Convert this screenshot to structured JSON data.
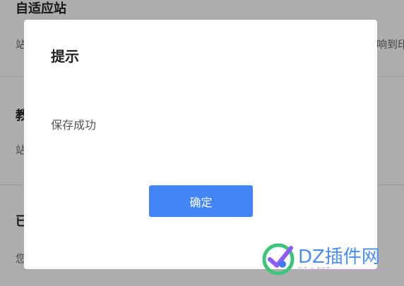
{
  "background": {
    "sections": [
      {
        "title": "自适应站",
        "desc": "站"
      },
      {
        "title": "教",
        "desc": "站"
      },
      {
        "title": "已",
        "desc": "您"
      }
    ],
    "right_text": "响到印"
  },
  "dialog": {
    "title": "提示",
    "message": "保存成功",
    "confirm_label": "确定"
  },
  "watermark": {
    "brand": "DZ插件网",
    "sub": "DZ-X.NET"
  },
  "colors": {
    "accent": "#4285f4",
    "overlay": "rgba(0,0,0,0.32)",
    "dialog_bg": "#ffffff"
  }
}
